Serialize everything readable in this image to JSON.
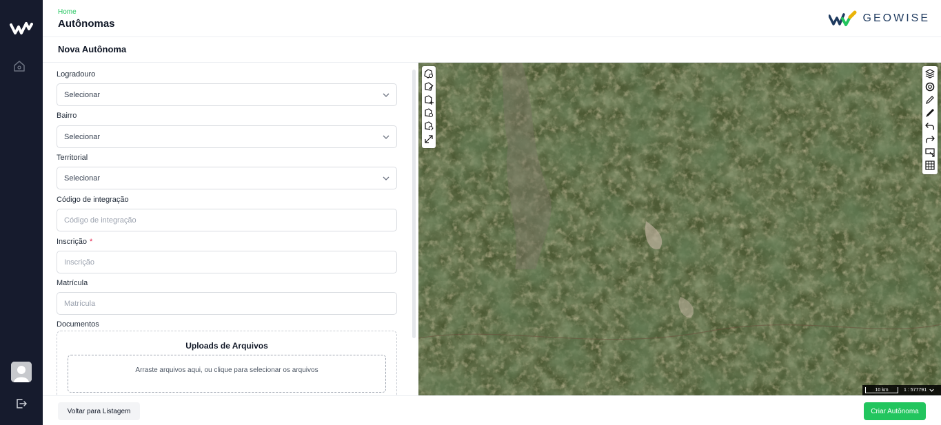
{
  "header": {
    "breadcrumb": "Home",
    "title": "Autônomas",
    "brand": "GEOWISE"
  },
  "subheader": {
    "title": "Nova Autônoma"
  },
  "form": {
    "logradouro": {
      "label": "Logradouro",
      "value": "Selecionar"
    },
    "bairro": {
      "label": "Bairro",
      "value": "Selecionar"
    },
    "territorial": {
      "label": "Territorial",
      "value": "Selecionar"
    },
    "codigo": {
      "label": "Código de integração",
      "placeholder": "Código de integração"
    },
    "inscricao": {
      "label": "Inscrição",
      "required_mark": "*",
      "placeholder": "Inscrição"
    },
    "matricula": {
      "label": "Matrícula",
      "placeholder": "Matrícula"
    },
    "documentos": {
      "label": "Documentos",
      "upload_title": "Uploads de Arquivos",
      "dropzone_text": "Arraste arquivos aqui, ou clique para selecionar os arquivos"
    }
  },
  "map": {
    "scale_label": "10 km",
    "scale_ratio": "1 : 577791",
    "left_tools": [
      "draw-polygon-icon",
      "edit-polygon-icon",
      "add-polygon-icon",
      "search-polygon-icon",
      "settings-polygon-icon",
      "expand-icon"
    ],
    "right_tools": [
      "layers-icon",
      "lifebuoy-icon",
      "pencil-icon",
      "brush-icon",
      "undo-icon",
      "redo-icon",
      "select-area-icon",
      "grid-icon"
    ]
  },
  "footer": {
    "back_label": "Voltar para Listagem",
    "create_label": "Criar Autônoma"
  },
  "colors": {
    "accent": "#22c55e",
    "sidebar": "#161b2d",
    "brand_navy": "#1e3a5f"
  }
}
